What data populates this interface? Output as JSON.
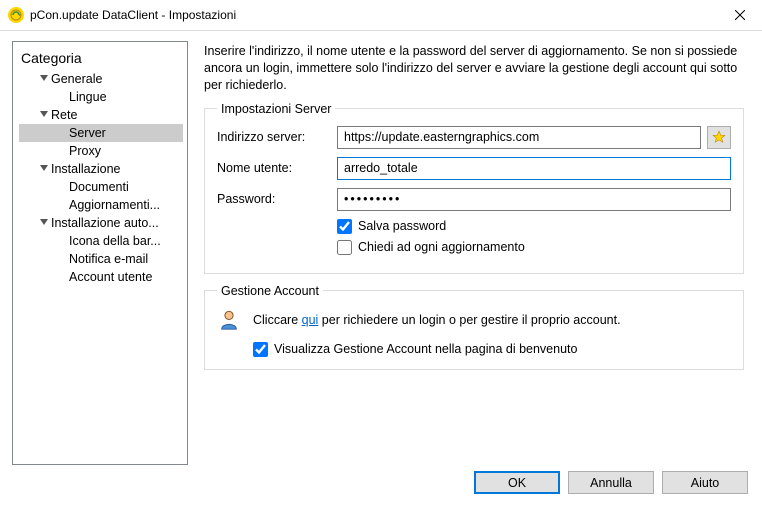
{
  "window": {
    "title": "pCon.update DataClient - Impostazioni"
  },
  "sidebar": {
    "title": "Categoria",
    "items": [
      {
        "label": "Generale",
        "level": 1,
        "expandable": true
      },
      {
        "label": "Lingue",
        "level": 2,
        "expandable": false
      },
      {
        "label": "Rete",
        "level": 1,
        "expandable": true
      },
      {
        "label": "Server",
        "level": 2,
        "expandable": false,
        "selected": true
      },
      {
        "label": "Proxy",
        "level": 2,
        "expandable": false
      },
      {
        "label": "Installazione",
        "level": 1,
        "expandable": true
      },
      {
        "label": "Documenti",
        "level": 2,
        "expandable": false
      },
      {
        "label": "Aggiornamenti...",
        "level": 2,
        "expandable": false
      },
      {
        "label": "Installazione auto...",
        "level": 1,
        "expandable": true
      },
      {
        "label": "Icona della bar...",
        "level": 2,
        "expandable": false
      },
      {
        "label": "Notifica e-mail",
        "level": 2,
        "expandable": false
      },
      {
        "label": "Account utente",
        "level": 2,
        "expandable": false
      }
    ]
  },
  "main": {
    "intro": "Inserire l'indirizzo, il nome utente e la password del server di aggiornamento. Se non si possiede ancora un login, immettere solo l'indirizzo del server e avviare la gestione degli account qui sotto per richiederlo.",
    "serverGroup": {
      "legend": "Impostazioni Server",
      "addressLabel": "Indirizzo server:",
      "addressValue": "https://update.easterngraphics.com",
      "userLabel": "Nome utente:",
      "userValue": "arredo_totale",
      "passwordLabel": "Password:",
      "passwordValue": "●●●●●●●●●",
      "savePassword": "Salva password",
      "savePasswordChecked": true,
      "askEveryUpdate": "Chiedi ad ogni aggiornamento",
      "askEveryUpdateChecked": false
    },
    "accountGroup": {
      "legend": "Gestione Account",
      "textBefore": "Cliccare ",
      "linkText": "qui",
      "textAfter": " per richiedere un login o per gestire il proprio account.",
      "showAccountMgmt": "Visualizza Gestione Account nella pagina di benvenuto",
      "showAccountMgmtChecked": true
    }
  },
  "footer": {
    "ok": "OK",
    "cancel": "Annulla",
    "help": "Aiuto"
  }
}
